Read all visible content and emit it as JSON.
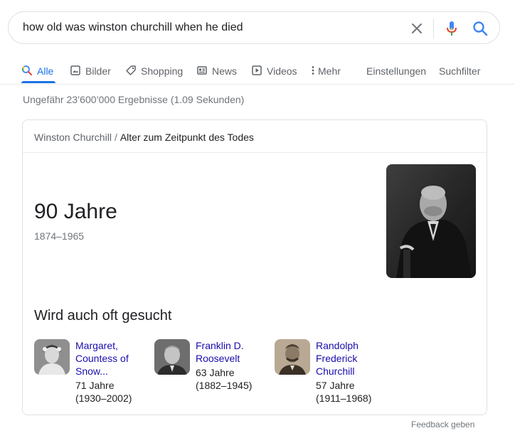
{
  "search": {
    "query": "how old was winston churchill when he died"
  },
  "tabs": [
    {
      "label": "Alle",
      "icon": "search-icon",
      "active": true
    },
    {
      "label": "Bilder",
      "icon": "image-icon"
    },
    {
      "label": "Shopping",
      "icon": "tag-icon"
    },
    {
      "label": "News",
      "icon": "newspaper-icon"
    },
    {
      "label": "Videos",
      "icon": "play-icon"
    },
    {
      "label": "Mehr",
      "icon": "more-vert-icon"
    }
  ],
  "tools": {
    "settings_label": "Einstellungen",
    "filters_label": "Suchfilter"
  },
  "result_stats": "Ungefähr 23’600’000 Ergebnisse (1.09 Sekunden)",
  "card": {
    "breadcrumb": {
      "root": "Winston Churchill",
      "separator": "/",
      "current": "Alter zum Zeitpunkt des Todes"
    },
    "answer": {
      "value": "90 Jahre",
      "range": "1874–1965"
    },
    "related": {
      "title": "Wird auch oft gesucht",
      "items": [
        {
          "name_lines": [
            "Margaret,",
            "Countess of",
            "Snow..."
          ],
          "age": "71 Jahre",
          "years": "(1930–2002)"
        },
        {
          "name_lines": [
            "Franklin D.",
            "Roosevelt"
          ],
          "age": "63 Jahre",
          "years": "(1882–1945)"
        },
        {
          "name_lines": [
            "Randolph",
            "Frederick",
            "Churchill"
          ],
          "age": "57 Jahre",
          "years": "(1911–1968)"
        }
      ]
    }
  },
  "feedback_label": "Feedback geben",
  "colors": {
    "link": "#1a0dab",
    "accent": "#1a73e8",
    "muted": "#70757a",
    "border": "#dfe1e5"
  }
}
